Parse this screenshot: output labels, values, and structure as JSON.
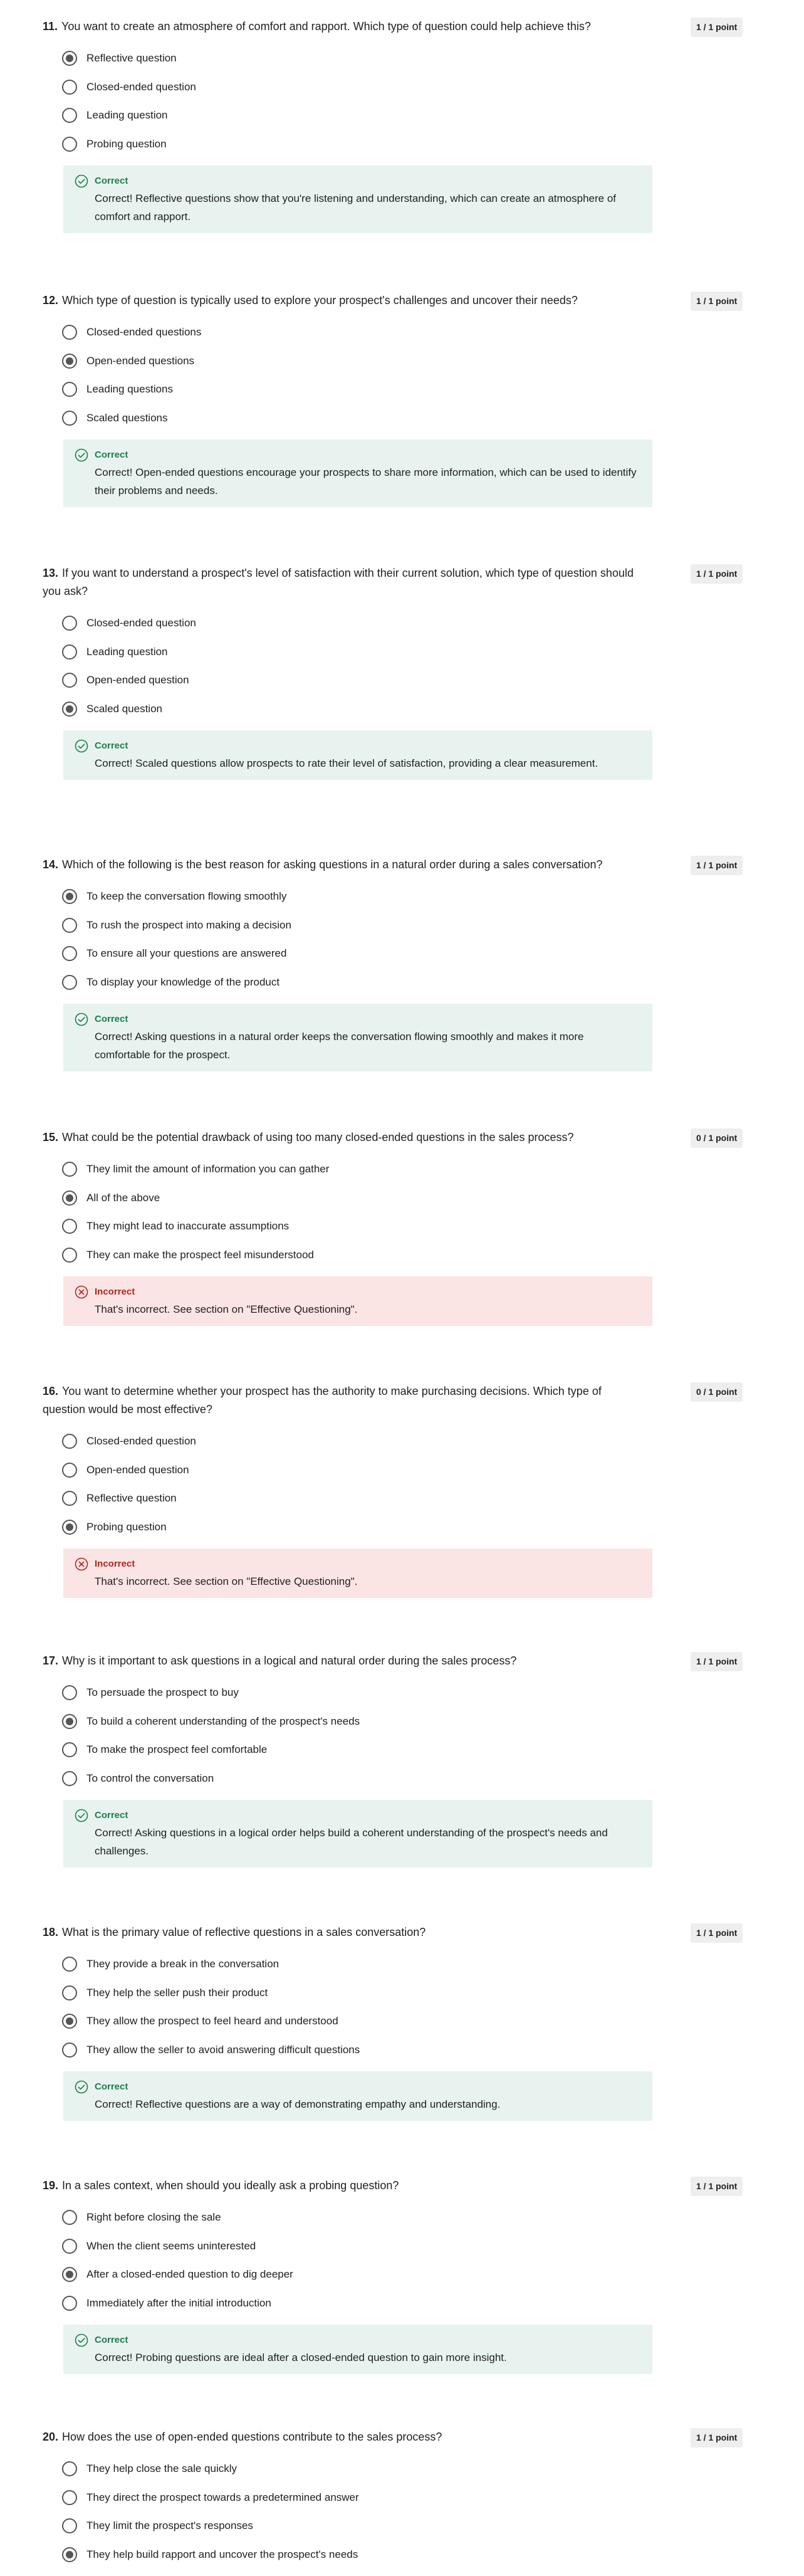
{
  "questions": [
    {
      "number": "11.",
      "text": "You want to create an atmosphere of comfort and rapport. Which type of question could help achieve this?",
      "score": "1 / 1 point",
      "options": [
        "Reflective question",
        "Closed-ended question",
        "Leading question",
        "Probing question"
      ],
      "selected": 0,
      "feedback": {
        "status": "correct",
        "title": "Correct",
        "text": "Correct! Reflective questions show that you're listening and understanding, which can create an atmosphere of comfort and rapport."
      }
    },
    {
      "number": "12.",
      "text": "Which type of question is typically used to explore your prospect's challenges and uncover their needs?",
      "score": "1 / 1 point",
      "options": [
        "Closed-ended questions",
        "Open-ended questions",
        "Leading questions",
        "Scaled questions"
      ],
      "selected": 1,
      "feedback": {
        "status": "correct",
        "title": "Correct",
        "text": "Correct! Open-ended questions encourage your prospects to share more information, which can be used to identify their problems and needs."
      }
    },
    {
      "number": "13.",
      "text": "If you want to understand a prospect's level of satisfaction with their current solution, which type of question should you ask?",
      "score": "1 / 1 point",
      "options": [
        "Closed-ended question",
        "Leading question",
        "Open-ended question",
        "Scaled question"
      ],
      "selected": 3,
      "feedback": {
        "status": "correct",
        "title": "Correct",
        "text": "Correct! Scaled questions allow prospects to rate their level of satisfaction, providing a clear measurement."
      }
    },
    {
      "number": "14.",
      "text": "Which of the following is the best reason for asking questions in a natural order during a sales conversation?",
      "score": "1 / 1 point",
      "options": [
        "To keep the conversation flowing smoothly",
        "To rush the prospect into making a decision",
        "To ensure all your questions are answered",
        "To display your knowledge of the product"
      ],
      "selected": 0,
      "feedback": {
        "status": "correct",
        "title": "Correct",
        "text": "Correct! Asking questions in a natural order keeps the conversation flowing smoothly and makes it more comfortable for the prospect."
      }
    },
    {
      "number": "15.",
      "text": "What could be the potential drawback of using too many closed-ended questions in the sales process?",
      "score": "0 / 1 point",
      "options": [
        "They limit the amount of information you can gather",
        "All of the above",
        "They might lead to inaccurate assumptions",
        "They can make the prospect feel misunderstood"
      ],
      "selected": 1,
      "feedback": {
        "status": "incorrect",
        "title": "Incorrect",
        "text": "That's incorrect. See section on \"Effective Questioning\"."
      }
    },
    {
      "number": "16.",
      "text": "You want to determine whether your prospect has the authority to make purchasing decisions. Which type of question would be most effective?",
      "score": "0 / 1 point",
      "options": [
        "Closed-ended question",
        "Open-ended question",
        "Reflective question",
        "Probing question"
      ],
      "selected": 3,
      "feedback": {
        "status": "incorrect",
        "title": "Incorrect",
        "text": "That's incorrect. See section on \"Effective Questioning\"."
      }
    },
    {
      "number": "17.",
      "text": "Why is it important to ask questions in a logical and natural order during the sales process?",
      "score": "1 / 1 point",
      "options": [
        "To persuade the prospect to buy",
        "To build a coherent understanding of the prospect's needs",
        "To make the prospect feel comfortable",
        "To control the conversation"
      ],
      "selected": 1,
      "feedback": {
        "status": "correct",
        "title": "Correct",
        "text": "Correct! Asking questions in a logical order helps build a coherent understanding of the prospect's needs and challenges."
      }
    },
    {
      "number": "18.",
      "text": "What is the primary value of reflective questions in a sales conversation?",
      "score": "1 / 1 point",
      "options": [
        "They provide a break in the conversation",
        "They help the seller push their product",
        "They allow the prospect to feel heard and understood",
        "They allow the seller to avoid answering difficult questions"
      ],
      "selected": 2,
      "feedback": {
        "status": "correct",
        "title": "Correct",
        "text": "Correct! Reflective questions are a way of demonstrating empathy and understanding."
      }
    },
    {
      "number": "19.",
      "text": "In a sales context, when should you ideally ask a probing question?",
      "score": "1 / 1 point",
      "options": [
        "Right before closing the sale",
        "When the client seems uninterested",
        "After a closed-ended question to dig deeper",
        "Immediately after the initial introduction"
      ],
      "selected": 2,
      "feedback": {
        "status": "correct",
        "title": "Correct",
        "text": "Correct! Probing questions are ideal after a closed-ended question to gain more insight."
      }
    },
    {
      "number": "20.",
      "text": "How does the use of open-ended questions contribute to the sales process?",
      "score": "1 / 1 point",
      "options": [
        "They help close the sale quickly",
        "They direct the prospect towards a predetermined answer",
        "They limit the prospect's responses",
        "They help build rapport and uncover the prospect's needs"
      ],
      "selected": 3,
      "feedback": null
    }
  ]
}
